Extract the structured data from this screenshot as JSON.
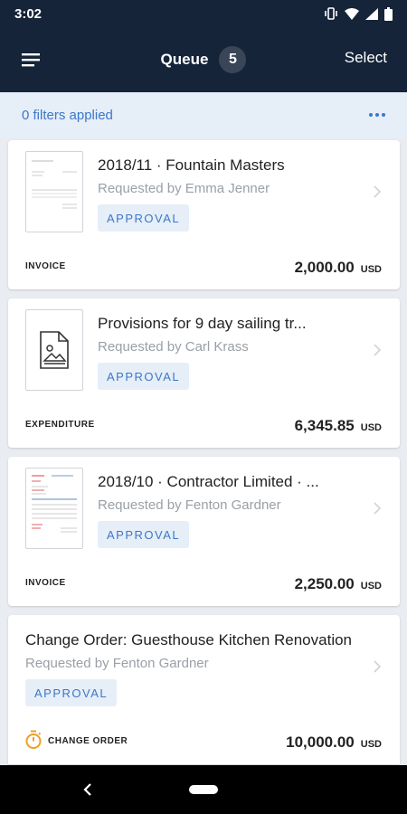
{
  "status_bar": {
    "time": "3:02"
  },
  "header": {
    "title": "Queue",
    "count": "5",
    "select_label": "Select"
  },
  "filter_bar": {
    "text": "0 filters applied"
  },
  "cards": [
    {
      "title": "2018/11 · Fountain Masters",
      "requested_by": "Requested by Emma Jenner",
      "badge": "APPROVAL",
      "type": "INVOICE",
      "amount": "2,000.00",
      "currency": "USD"
    },
    {
      "title": "Provisions for 9 day sailing tr...",
      "requested_by": "Requested by Carl Krass",
      "badge": "APPROVAL",
      "type": "EXPENDITURE",
      "amount": "6,345.85",
      "currency": "USD"
    },
    {
      "title": "2018/10 · Contractor Limited · ...",
      "requested_by": "Requested by Fenton Gardner",
      "badge": "APPROVAL",
      "type": "INVOICE",
      "amount": "2,250.00",
      "currency": "USD"
    },
    {
      "title": "Change Order: Guesthouse Kitchen Renovation",
      "requested_by": "Requested by Fenton Gardner",
      "badge": "APPROVAL",
      "type": "CHANGE ORDER",
      "amount": "10,000.00",
      "currency": "USD"
    }
  ],
  "icons": {
    "menu": "menu-icon",
    "more": "more-horizontal-icon",
    "chevron": "chevron-right-icon",
    "image_placeholder": "image-placeholder-icon",
    "timer": "timer-icon",
    "vibrate": "vibrate-icon",
    "wifi": "wifi-icon",
    "signal": "signal-icon",
    "battery": "battery-icon",
    "back": "back-icon",
    "home": "home-pill-icon"
  },
  "colors": {
    "header_bg": "#16243a",
    "accent": "#3c78c8",
    "badge_bg": "#e6eef8",
    "page_bg": "#e9ecf0",
    "timer": "#f0a020"
  }
}
